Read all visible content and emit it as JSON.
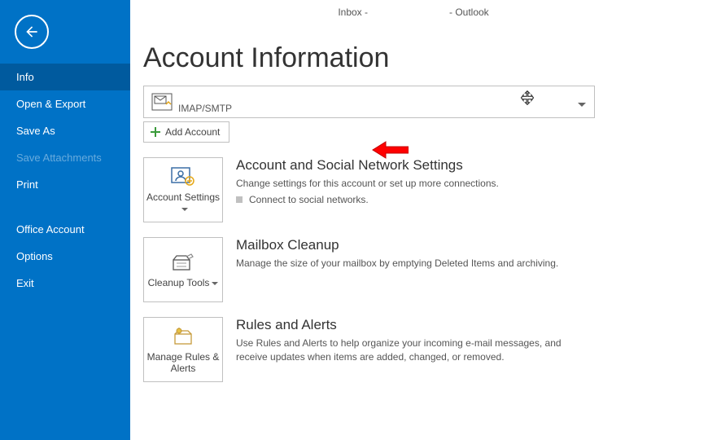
{
  "titlebar": {
    "left": "Inbox -",
    "right": "- Outlook"
  },
  "page_title": "Account Information",
  "sidebar": {
    "items": [
      {
        "label": "Info"
      },
      {
        "label": "Open & Export"
      },
      {
        "label": "Save As"
      },
      {
        "label": "Save Attachments"
      },
      {
        "label": "Print"
      },
      {
        "label": "Office Account"
      },
      {
        "label": "Options"
      },
      {
        "label": "Exit"
      }
    ]
  },
  "account_picker": {
    "type_label": "IMAP/SMTP"
  },
  "add_account": {
    "label": "Add Account"
  },
  "sections": {
    "account_settings": {
      "tile_label": "Account Settings",
      "title": "Account and Social Network Settings",
      "desc": "Change settings for this account or set up more connections.",
      "bullet": "Connect to social networks."
    },
    "cleanup": {
      "tile_label": "Cleanup Tools",
      "title": "Mailbox Cleanup",
      "desc": "Manage the size of your mailbox by emptying Deleted Items and archiving."
    },
    "rules": {
      "tile_label": "Manage Rules & Alerts",
      "title": "Rules and Alerts",
      "desc": "Use Rules and Alerts to help organize your incoming e-mail messages, and receive updates when items are added, changed, or removed."
    }
  }
}
